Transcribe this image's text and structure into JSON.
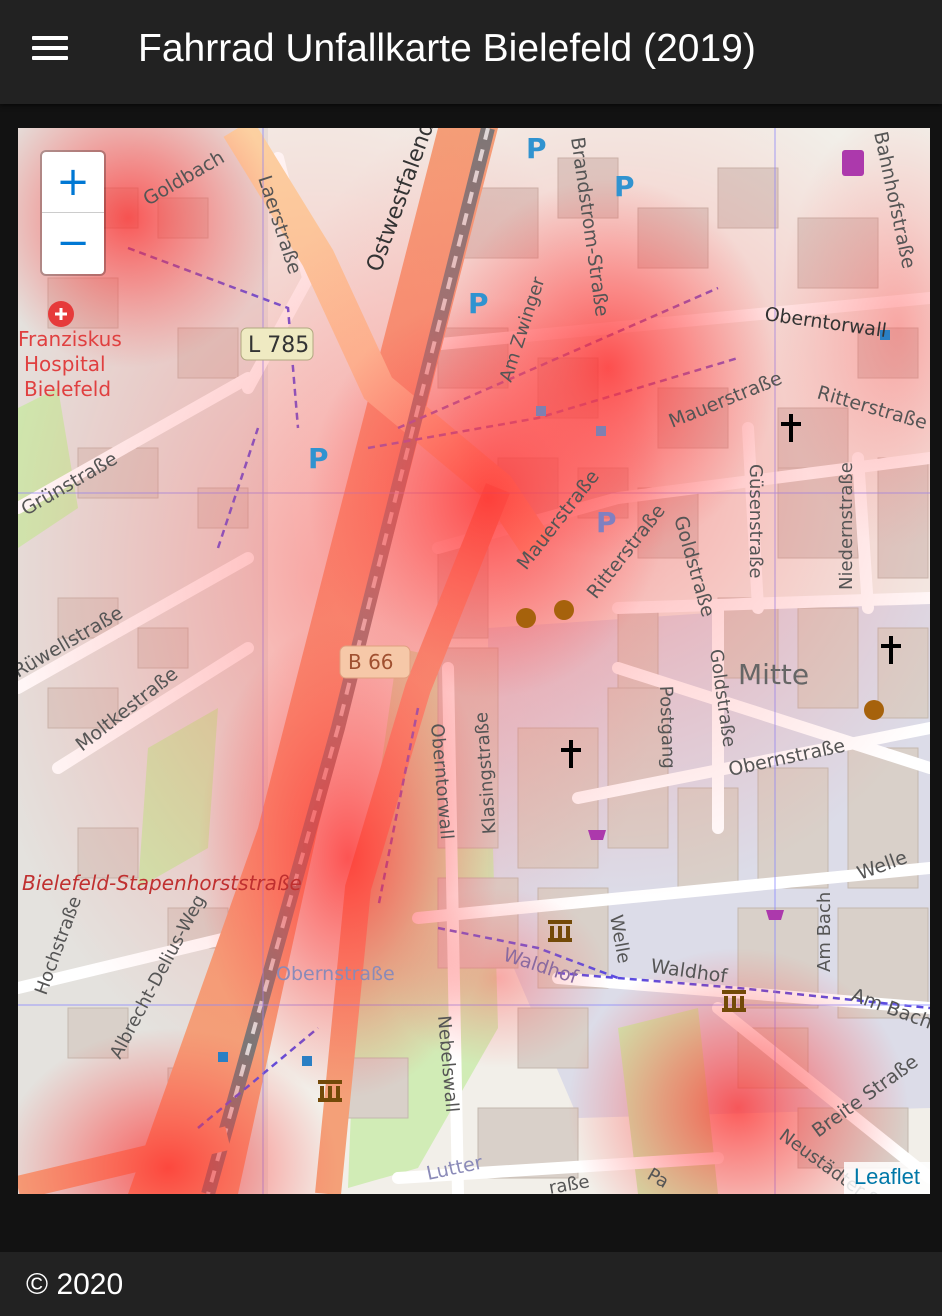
{
  "app": {
    "title": "Fahrrad Unfallkarte Bielefeld (2019)",
    "menu_icon": "hamburger-menu-icon"
  },
  "map": {
    "zoom_in_label": "+",
    "zoom_out_label": "−",
    "attribution": "Leaflet",
    "labels": {
      "goldbach": "Goldbach",
      "laerstrasse": "Laerstraße",
      "ostwestfalendamm": "Ostwestfalendamm",
      "brandstrom": "Brandstrom-Straße",
      "bahnhofstrasse": "Bahnhofstraße",
      "hospital_1": "Franziskus",
      "hospital_2": "Hospital",
      "hospital_3": "Bielefeld",
      "l785": "L 785",
      "am_zwinger": "Am Zwinger",
      "oberntorwall_top": "Oberntorwall",
      "maurstrasse_top": "Mauerstraße",
      "ritterstrasse_top": "Ritterstraße",
      "gruenstrasse": "Grünstraße",
      "mauerstrasse_mid": "Mauerstraße",
      "ritterstrasse_mid": "Ritterstraße",
      "goldstrasse_top": "Goldstraße",
      "guesenstrasse": "Güsenstraße",
      "niedernstrasse": "Niedernstraße",
      "rueelwellstrasse": "Rüwellstraße",
      "b66": "B 66",
      "mitte": "Mitte",
      "moltkestrasse": "Moltkestraße",
      "oberntorwall_mid": "Oberntorwall",
      "klasingstrasse": "Klasingstraße",
      "postgang": "Postgang",
      "goldstrasse_mid": "Goldstraße",
      "obernstrasse_right": "Obernstraße",
      "stapenhorst": "Bielefeld-Stapenhorststraße",
      "welle_right": "Welle",
      "hochstrasse": "Hochstraße",
      "albrecht": "Albrecht-Delius-Weg",
      "obernstrasse_left": "Obernstraße",
      "waldhof_left": "Waldhof",
      "welle_mid": "Welle",
      "waldhof_right": "Waldhof",
      "am_bach_v": "Am Bach",
      "am_bach_h": "Am Bach",
      "nebelswall": "Nebelswall",
      "breite_strasse": "Breite Straße",
      "lutter": "Lutter",
      "neustaedter": "Neustädter S",
      "strasse_bottom": "raße",
      "pa_bottom": "Pa",
      "parking": "P"
    }
  },
  "footer": {
    "copyright": "© 2020"
  },
  "colors": {
    "appbar": "#222222",
    "background": "#121212",
    "accent": "#0078d4",
    "heat": "#ff3c3c",
    "major_road": "#f4a078",
    "rail": "#777777"
  }
}
